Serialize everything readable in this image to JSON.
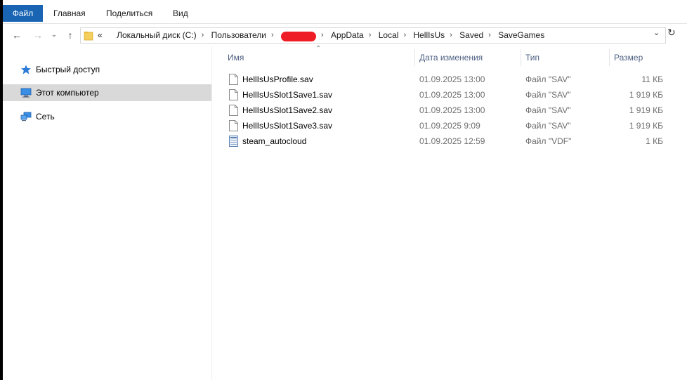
{
  "ribbon": {
    "tabs": [
      "Файл",
      "Главная",
      "Поделиться",
      "Вид"
    ]
  },
  "address": {
    "prefix": "«",
    "crumbs": [
      "Локальный диск (C:)",
      "Пользователи",
      "AppData",
      "Local",
      "HellIsUs",
      "Saved",
      "SaveGames"
    ],
    "redacted_color": "#ee1c24"
  },
  "sidebar": {
    "items": [
      {
        "label": "Быстрый доступ",
        "icon": "star-icon"
      },
      {
        "label": "Этот компьютер",
        "icon": "computer-icon"
      },
      {
        "label": "Сеть",
        "icon": "network-icon"
      }
    ]
  },
  "columns": {
    "name": "Имя",
    "date": "Дата изменения",
    "type": "Тип",
    "size": "Размер"
  },
  "files": [
    {
      "name": "HellIsUsProfile.sav",
      "date": "01.09.2025 13:00",
      "type": "Файл \"SAV\"",
      "size": "11 КБ",
      "icon": "file-icon"
    },
    {
      "name": "HellIsUsSlot1Save1.sav",
      "date": "01.09.2025 13:00",
      "type": "Файл \"SAV\"",
      "size": "1 919 КБ",
      "icon": "file-icon"
    },
    {
      "name": "HellIsUsSlot1Save2.sav",
      "date": "01.09.2025 13:00",
      "type": "Файл \"SAV\"",
      "size": "1 919 КБ",
      "icon": "file-icon"
    },
    {
      "name": "HellIsUsSlot1Save3.sav",
      "date": "01.09.2025 9:09",
      "type": "Файл \"SAV\"",
      "size": "1 919 КБ",
      "icon": "file-icon"
    },
    {
      "name": "steam_autocloud",
      "date": "01.09.2025 12:59",
      "type": "Файл \"VDF\"",
      "size": "1 КБ",
      "icon": "vdf-file-icon"
    }
  ],
  "colors": {
    "file_tab": "#1a64b4",
    "selected_sidebar": "#d9d9d9",
    "header_text": "#4d6082"
  }
}
